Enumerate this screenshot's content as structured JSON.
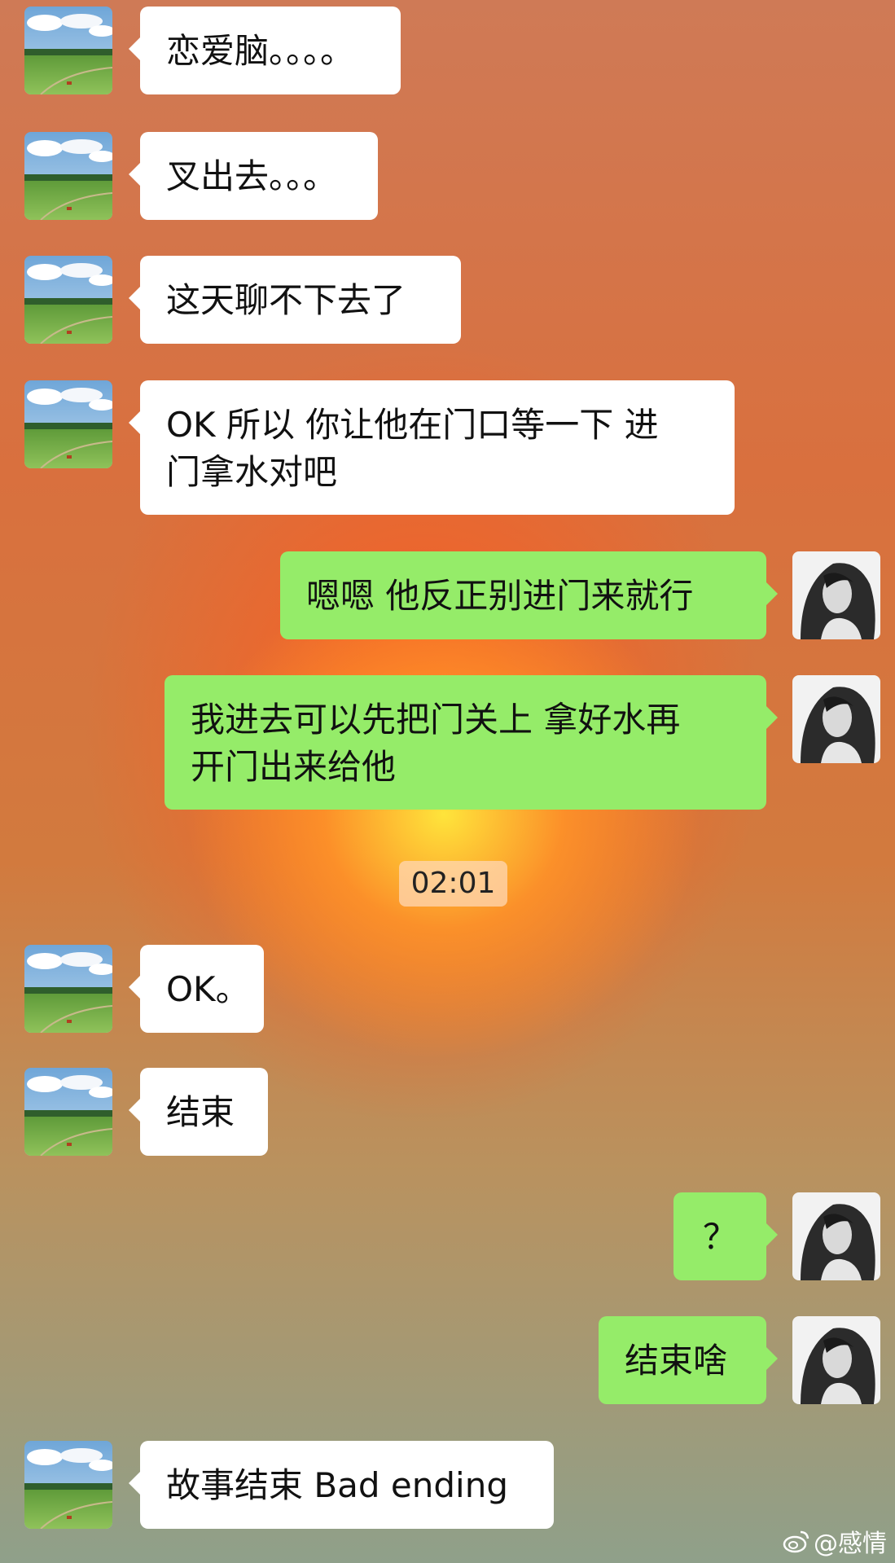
{
  "messages": [
    {
      "side": "in",
      "text": "恋爱脑。。。。"
    },
    {
      "side": "in",
      "text": "叉出去。。。"
    },
    {
      "side": "in",
      "text": "这天聊不下去了"
    },
    {
      "side": "in",
      "text": "OK 所以 你让他在门口等一下 进\n门拿水对吧"
    },
    {
      "side": "out",
      "text": "嗯嗯 他反正别进门来就行"
    },
    {
      "side": "out",
      "text": "我进去可以先把门关上 拿好水再\n开门出来给他"
    },
    {
      "side": "in",
      "text": "OK。"
    },
    {
      "side": "in",
      "text": "结束"
    },
    {
      "side": "out",
      "text": "？"
    },
    {
      "side": "out",
      "text": "结束啥"
    },
    {
      "side": "in",
      "text": "故事结束 Bad ending"
    }
  ],
  "timestamp": "02:01",
  "watermark": "@感情",
  "icons": {
    "watermark": "weibo-icon",
    "contact_avatar": "landscape-avatar-icon",
    "self_avatar": "portrait-avatar-icon"
  }
}
